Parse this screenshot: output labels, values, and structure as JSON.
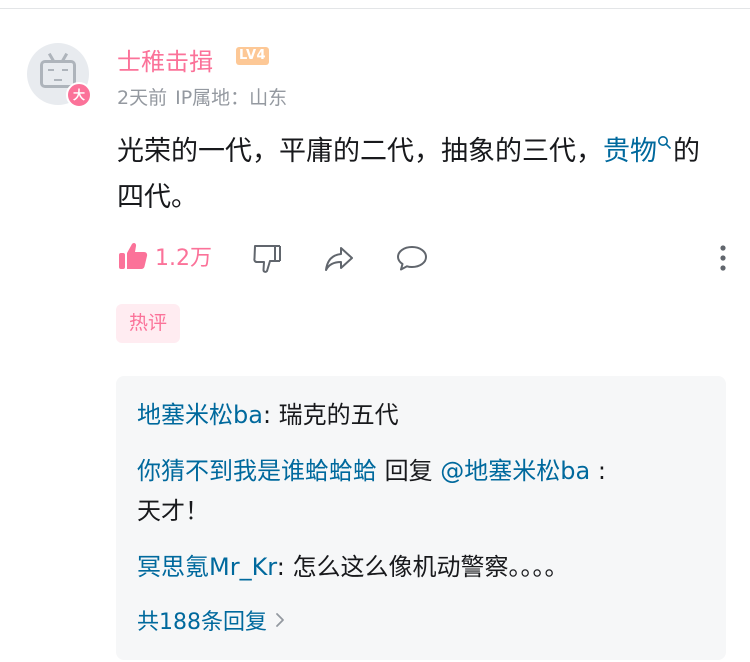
{
  "comment": {
    "username": "士稚击揖",
    "level_badge": "LV4",
    "vip_badge": "大",
    "time": "2天前",
    "ip_label": "IP属地：山东",
    "content_prefix": "光荣的一代，平庸的二代，抽象的三代，",
    "content_link": "贵物",
    "content_suffix": "的四代。",
    "like_count": "1.2万",
    "hot_tag": "热评",
    "colors": {
      "accent_pink": "#fb7299",
      "link_blue": "#00699d",
      "muted": "#9499a0",
      "icon_gray": "#61666d"
    }
  },
  "replies": [
    {
      "name": "地塞米松ba",
      "colon": ": ",
      "text": "瑞克的五代"
    },
    {
      "name": "你猜不到我是谁蛤蛤蛤",
      "reply_word": " 回复 ",
      "mention": "@地塞米松ba",
      "colon": " : ",
      "text": "天才！"
    },
    {
      "name": "冥思氪Mr_Kr",
      "colon": ": ",
      "text": "怎么这么像机动警察。。。。"
    }
  ],
  "reply_count_label": "共188条回复",
  "icons": {
    "like": "thumbs-up-icon",
    "dislike": "thumbs-down-icon",
    "share": "share-icon",
    "reply": "comment-bubble-icon",
    "more": "more-vertical-icon",
    "search": "search-icon",
    "chevron": "chevron-right-icon"
  }
}
